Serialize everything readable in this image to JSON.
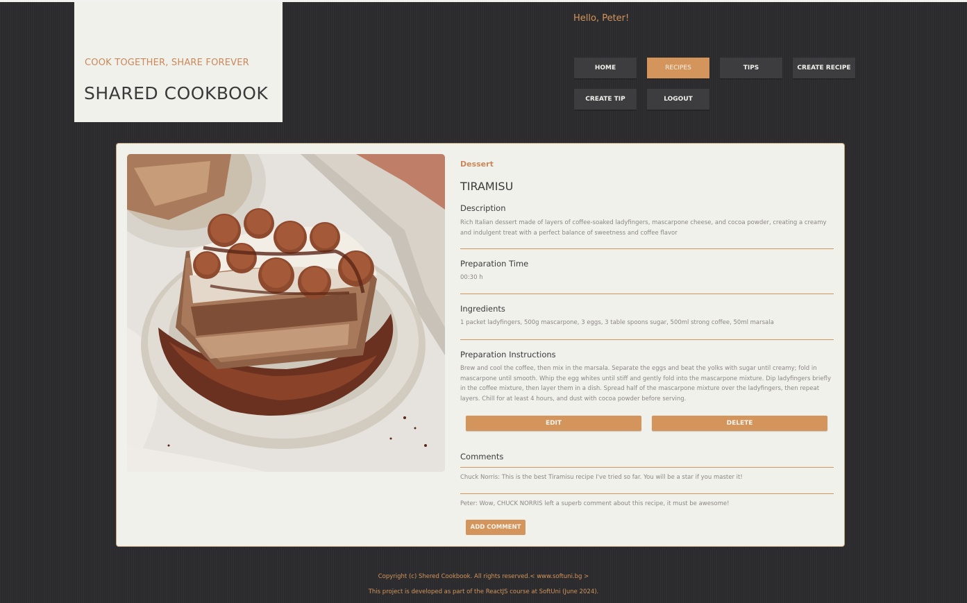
{
  "header": {
    "tagline": "Cook Together, Share Forever",
    "title": "SHARED COOKBOOK",
    "greeting": "Hello, Peter!"
  },
  "nav": {
    "home": "Home",
    "recipes": "Recipes",
    "tips": "Tips",
    "create_recipe": "Create Recipe",
    "create_tip": "Create Tip",
    "logout": "Logout",
    "active": "recipes"
  },
  "recipe": {
    "category": "Dessert",
    "title": "Tiramisu",
    "description_label": "Description",
    "description": "Rich Italian dessert made of layers of coffee-soaked ladyfingers, mascarpone cheese, and cocoa powder, creating a creamy and indulgent treat with a perfect balance of sweetness and coffee flavor",
    "prep_time_label": "Preparation Time",
    "prep_time": "00:30 h",
    "ingredients_label": "Ingredients",
    "ingredients": "1 packet ladyfingers, 500g mascarpone, 3 eggs, 3 table spoons sugar, 500ml strong coffee, 50ml marsala",
    "instructions_label": "Preparation Instructions",
    "instructions": "Brew and cool the coffee, then mix in the marsala. Separate the eggs and beat the yolks with sugar until creamy; fold in mascarpone until smooth. Whip the egg whites until stiff and gently fold into the mascarpone mixture. Dip ladyfingers briefly in the coffee mixture, then layer them in a dish. Spread half of the mascarpone mixture over the ladyfingers, then repeat layers. Chill for at least 4 hours, and dust with cocoa powder before serving.",
    "edit_label": "Edit",
    "delete_label": "Delete"
  },
  "comments": {
    "label": "Comments",
    "items": [
      "Chuck Norris: This is the best Tiramisu recipe I've tried so far. You will be a star if you master it!",
      "Peter: Wow, CHUCK NORRIS left a superb comment about this recipe, it must be awesome!"
    ],
    "add_label": "Add Comment"
  },
  "footer": {
    "copyright": "Copyright (c) Shered Cookbook. All rights reserved.< www.softuni.bg >",
    "note": "This project is developed as part of the ReactJS course at SoftUni (June 2024)."
  },
  "colors": {
    "accent": "#d4955c",
    "background": "#2b2b2d",
    "panel": "#f1f1ec",
    "nav_button": "#3d3d40"
  }
}
